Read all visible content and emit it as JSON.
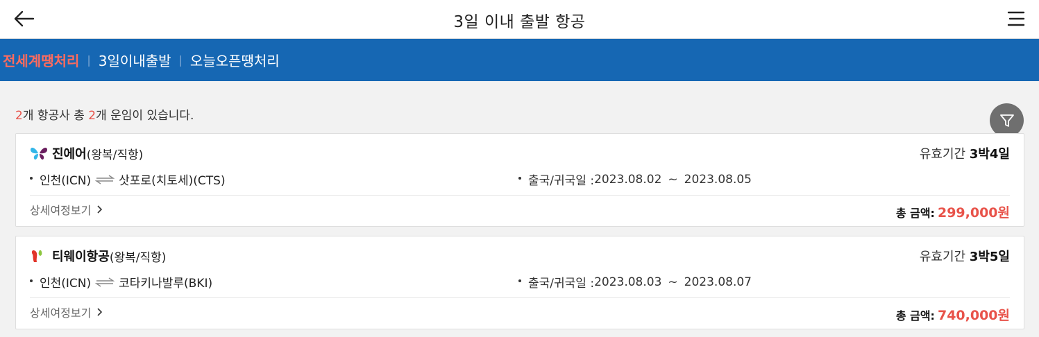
{
  "header": {
    "title": "3일 이내 출발 항공"
  },
  "tabs": [
    {
      "label": "전세계땡처리",
      "active": true
    },
    {
      "label": "3일이내출발",
      "active": false
    },
    {
      "label": "오늘오픈땡처리",
      "active": false
    }
  ],
  "summary": {
    "airline_count": "2",
    "text1": "개 항공사 총 ",
    "fare_count": "2",
    "text2": "개 운임이 있습니다."
  },
  "colors": {
    "header_bar": "#1667b3",
    "accent": "#e8534a",
    "active_tab": "#ff6b5e"
  },
  "fares": [
    {
      "airline": "진에어",
      "trip_type": "(왕복/직항)",
      "logo": "jinair-butterfly-logo",
      "validity_label": "유효기간",
      "validity": "3박4일",
      "origin": "인천(ICN)",
      "destination": "삿포로(치토세)(CTS)",
      "dates_label": "출국/귀국일 : ",
      "depart": "2023.08.02",
      "tilde": "~",
      "return": "2023.08.05",
      "detail_label": "상세여정보기",
      "total_label": "총 금액:",
      "price": "299,000원"
    },
    {
      "airline": "티웨이항공",
      "trip_type": "(왕복/직항)",
      "logo": "tway-logo",
      "validity_label": "유효기간",
      "validity": "3박5일",
      "origin": "인천(ICN)",
      "destination": "코타키나발루(BKI)",
      "dates_label": "출국/귀국일 : ",
      "depart": "2023.08.03",
      "tilde": "~",
      "return": "2023.08.07",
      "detail_label": "상세여정보기",
      "total_label": "총 금액:",
      "price": "740,000원"
    }
  ]
}
